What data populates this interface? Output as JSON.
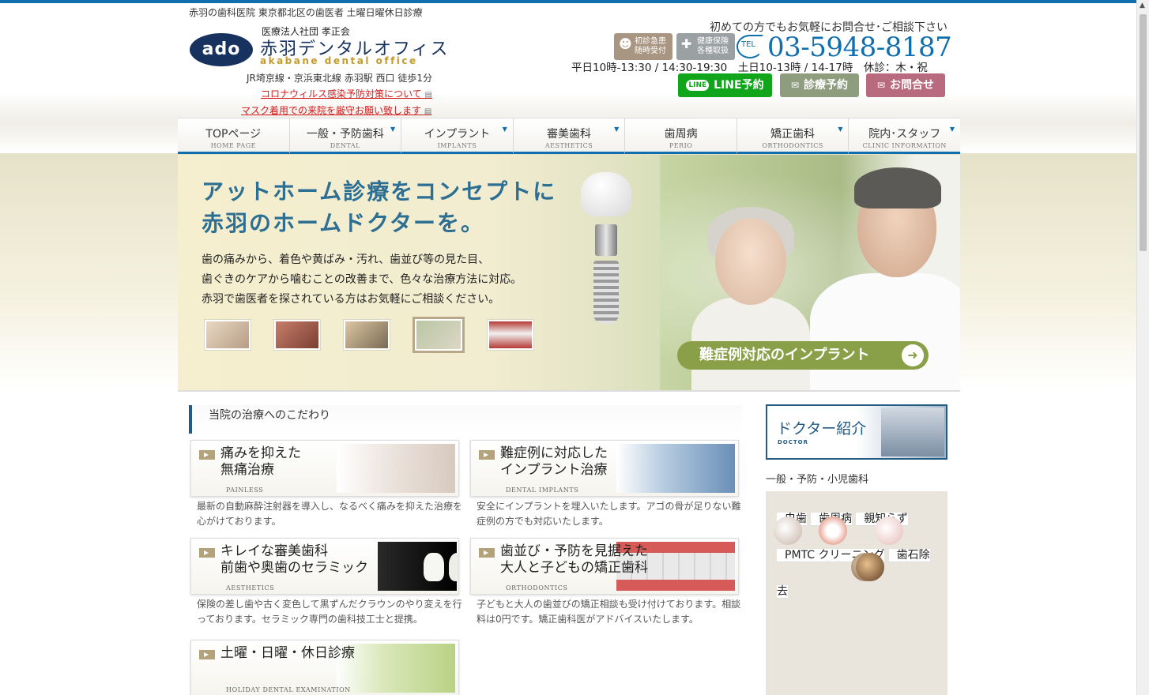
{
  "header": {
    "tagline": "赤羽の歯科医院 東京都北区の歯医者 土曜日曜休日診療",
    "logo_text": "ado",
    "corporation": "医療法人社団 孝正会",
    "clinic_name": "赤羽デンタルオフィス",
    "clinic_name_en": "akabane dental office",
    "access": "JR埼京線・京浜東北線 赤羽駅 西口 徒歩1分",
    "notice_covid": "コロナウィルス感染予防対策について",
    "notice_mask": "マスク着用での来院を厳守お願い致します",
    "inquire": "初めての方でもお気軽にお問合せ･ご相談下さい",
    "badge_emergency": "初診急患\n随時受付",
    "badge_insurance": "健康保険\n各種取扱",
    "tel_label": "TEL",
    "tel": "03-5948-8187",
    "hours": "平日10時-13:30 / 14:30-19:30　土日10-13時 / 14-17時　休診：木・祝",
    "cta_line": "LINE予約",
    "cta_line_mini": "LINE",
    "cta_reserve": "診療予約",
    "cta_inquiry": "お問合せ"
  },
  "nav": [
    {
      "jp": "TOPページ",
      "en": "HOME PAGE",
      "dropdown": false
    },
    {
      "jp": "一般・予防歯科",
      "en": "DENTAL",
      "dropdown": true
    },
    {
      "jp": "インプラント",
      "en": "IMPLANTS",
      "dropdown": true
    },
    {
      "jp": "審美歯科",
      "en": "AESTHETICS",
      "dropdown": true
    },
    {
      "jp": "歯周病",
      "en": "PERIO",
      "dropdown": false
    },
    {
      "jp": "矯正歯科",
      "en": "ORTHODONTICS",
      "dropdown": true
    },
    {
      "jp": "院内･スタッフ",
      "en": "CLINIC INFORMATION",
      "dropdown": true
    }
  ],
  "hero": {
    "title_line1": "アットホーム診療をコンセプトに",
    "title_line2": "赤羽のホームドクターを。",
    "text_line1": "歯の痛みから、着色や黄ばみ・汚れ、歯並び等の見た目、",
    "text_line2": "歯ぐきのケアから噛むことの改善まで、色々な治療方法に対応。",
    "text_line3": "赤羽で歯医者を探されている方はお気軽にご相談ください。",
    "button": "難症例対応のインプラント",
    "active_slide": 4
  },
  "section": {
    "title": "当院の治療へのこだわり"
  },
  "cards": [
    {
      "title": "痛みを抑えた\n無痛治療",
      "en": "PAINLESS",
      "desc": "最新の自動麻酔注射器を導入し、なるべく痛みを抑えた治療を心がけております。"
    },
    {
      "title": "難症例に対応した\nインプラント治療",
      "en": "DENTAL IMPLANTS",
      "desc": "安全にインプラントを埋入いたします。アゴの骨が足りない難症例の方でも対応いたします。"
    },
    {
      "title": "キレイな審美歯科\n前歯や奥歯のセラミック",
      "en": "AESTHETICS",
      "desc": "保険の差し歯や古く変色して黒ずんだクラウンのやり変えを行っております。セラミック専門の歯科技工士と提携。"
    },
    {
      "title": "歯並び・予防を見据えた\n大人と子どもの矯正歯科",
      "en": "ORTHODONTICS",
      "desc": "子どもと大人の歯並びの矯正相談も受け付けております。相談料は0円です。矯正歯科医がアドバイスいたします。"
    },
    {
      "title": "土曜・日曜・休日診療",
      "en": "HOLIDAY DENTAL EXAMINATION",
      "desc": ""
    }
  ],
  "sidebar": {
    "doctor_jp": "ドクター紹介",
    "doctor_en": "DOCTOR",
    "general_title": "一般・予防・小児歯科",
    "items": [
      {
        "label": "虫歯"
      },
      {
        "label": "歯周病"
      },
      {
        "label": "親知らず"
      },
      {
        "label": "PMTC クリーニング"
      },
      {
        "label": "歯石除去"
      }
    ]
  },
  "colors": {
    "brand_blue": "#0f6fae",
    "navy": "#17325e",
    "gold": "#c49a2a",
    "line_green": "#11a51c",
    "notice_red": "#d01b1b"
  }
}
